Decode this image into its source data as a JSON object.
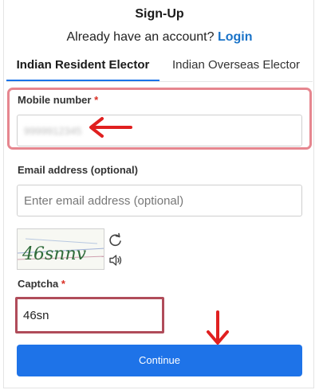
{
  "header": {
    "title": "Sign-Up",
    "account_prompt": "Already have an account?",
    "login_label": "Login"
  },
  "tabs": [
    {
      "label": "Indian Resident Elector",
      "active": true
    },
    {
      "label": "Indian Overseas Elector",
      "active": false
    }
  ],
  "form": {
    "mobile": {
      "label": "Mobile number",
      "required_mark": "*",
      "value": "9999912345"
    },
    "email": {
      "label": "Email address (optional)",
      "placeholder": "Enter email address (optional)"
    },
    "captcha_image_text": "46snnv",
    "captcha": {
      "label": "Captcha",
      "required_mark": "*",
      "value": "46sn"
    },
    "continue_label": "Continue"
  },
  "colors": {
    "accent": "#1e73e8",
    "link": "#1a73c8",
    "highlight": "#e6868f",
    "arrow": "#e02020"
  },
  "icons": {
    "refresh": "refresh-icon",
    "audio": "audio-icon",
    "arrow_left": "red-arrow-left-icon",
    "arrow_down": "red-arrow-down-icon"
  }
}
